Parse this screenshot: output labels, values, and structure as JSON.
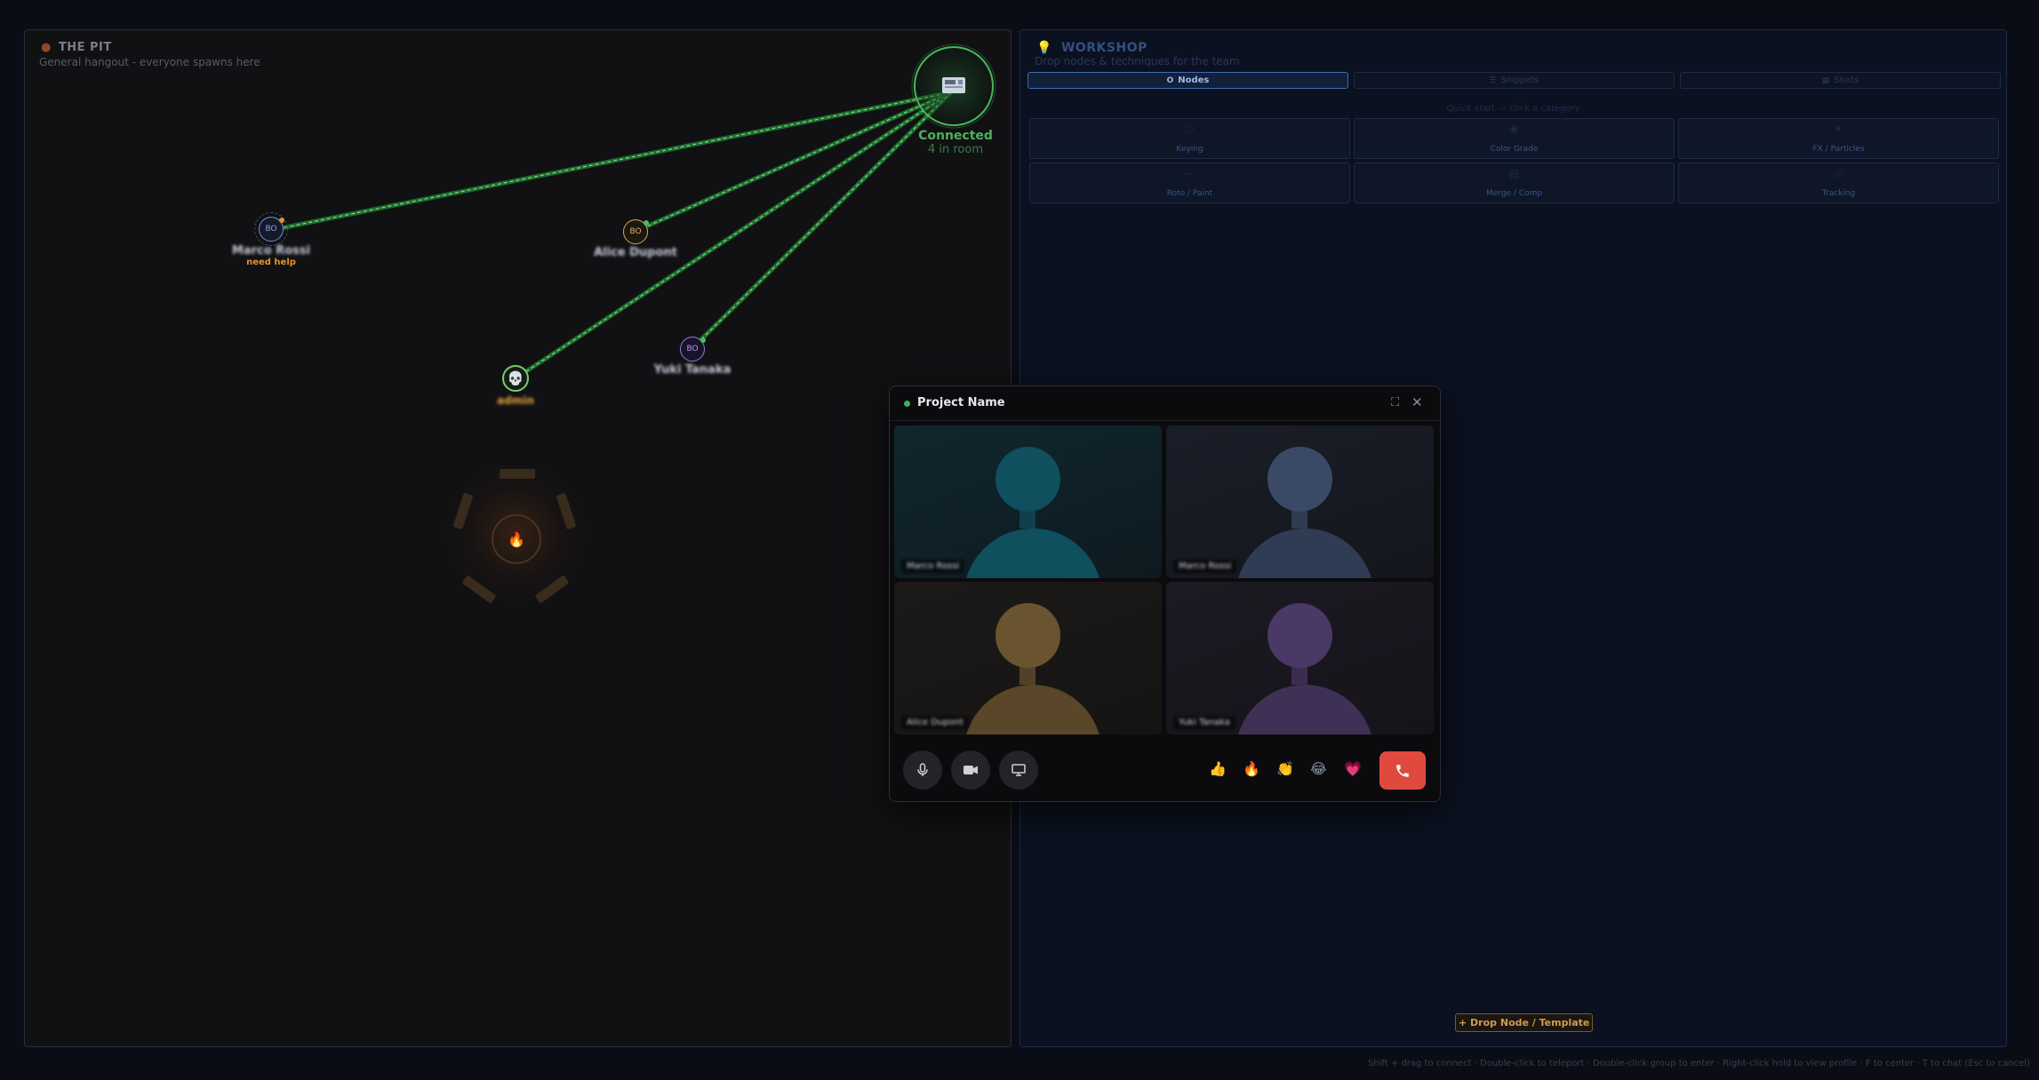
{
  "pit": {
    "title": "THE PIT",
    "subtitle": "General hangout - everyone spawns here"
  },
  "server": {
    "status": "Connected",
    "room_count": "4 in room"
  },
  "users": [
    {
      "initials": "BO",
      "name": "Marco Rossi",
      "status": "need help",
      "color": "#6f8ee0"
    },
    {
      "initials": "BO",
      "name": "Alice Dupont",
      "color": "#d9a45a"
    },
    {
      "initials": "BO",
      "name": "Yuki Tanaka",
      "color": "#9a7ad8"
    },
    {
      "initials": "",
      "name": "admin",
      "color": "#e3a23a"
    }
  ],
  "workshop": {
    "title": "WORKSHOP",
    "subtitle": "Drop nodes & techniques for the team",
    "tabs": [
      {
        "label": "Nodes",
        "icon": "O"
      },
      {
        "label": "Snippets",
        "icon": "☰"
      },
      {
        "label": "Shots",
        "icon": "▦"
      }
    ],
    "quick_start": "Quick start — click a category",
    "categories": [
      "Keying",
      "Color Grade",
      "FX / Particles",
      "Roto / Paint",
      "Merge / Comp",
      "Tracking"
    ],
    "drop_button": "+ Drop Node / Template"
  },
  "call": {
    "title": "Project Name",
    "participants": [
      {
        "name": "Marco Rossi",
        "color": "#0f4f5e"
      },
      {
        "name": "Marco Rossi",
        "color": "#3a4a66"
      },
      {
        "name": "Alice Dupont",
        "color": "#6a5430"
      },
      {
        "name": "Yuki Tanaka",
        "color": "#4a3866"
      }
    ],
    "reactions": [
      "👍",
      "🔥",
      "👏",
      "😂",
      "💗"
    ]
  },
  "hint": "Shift + drag to connect · Double-click to teleport · Double-click group to enter · Right-click hold to view profile · F to center · T to chat (Esc to cancel)",
  "colors": {
    "accent_green": "#4cb25a",
    "accent_orange": "#e0922e",
    "hangup_red": "#e04a3e",
    "tab_active_blue": "#3f6ab0"
  }
}
